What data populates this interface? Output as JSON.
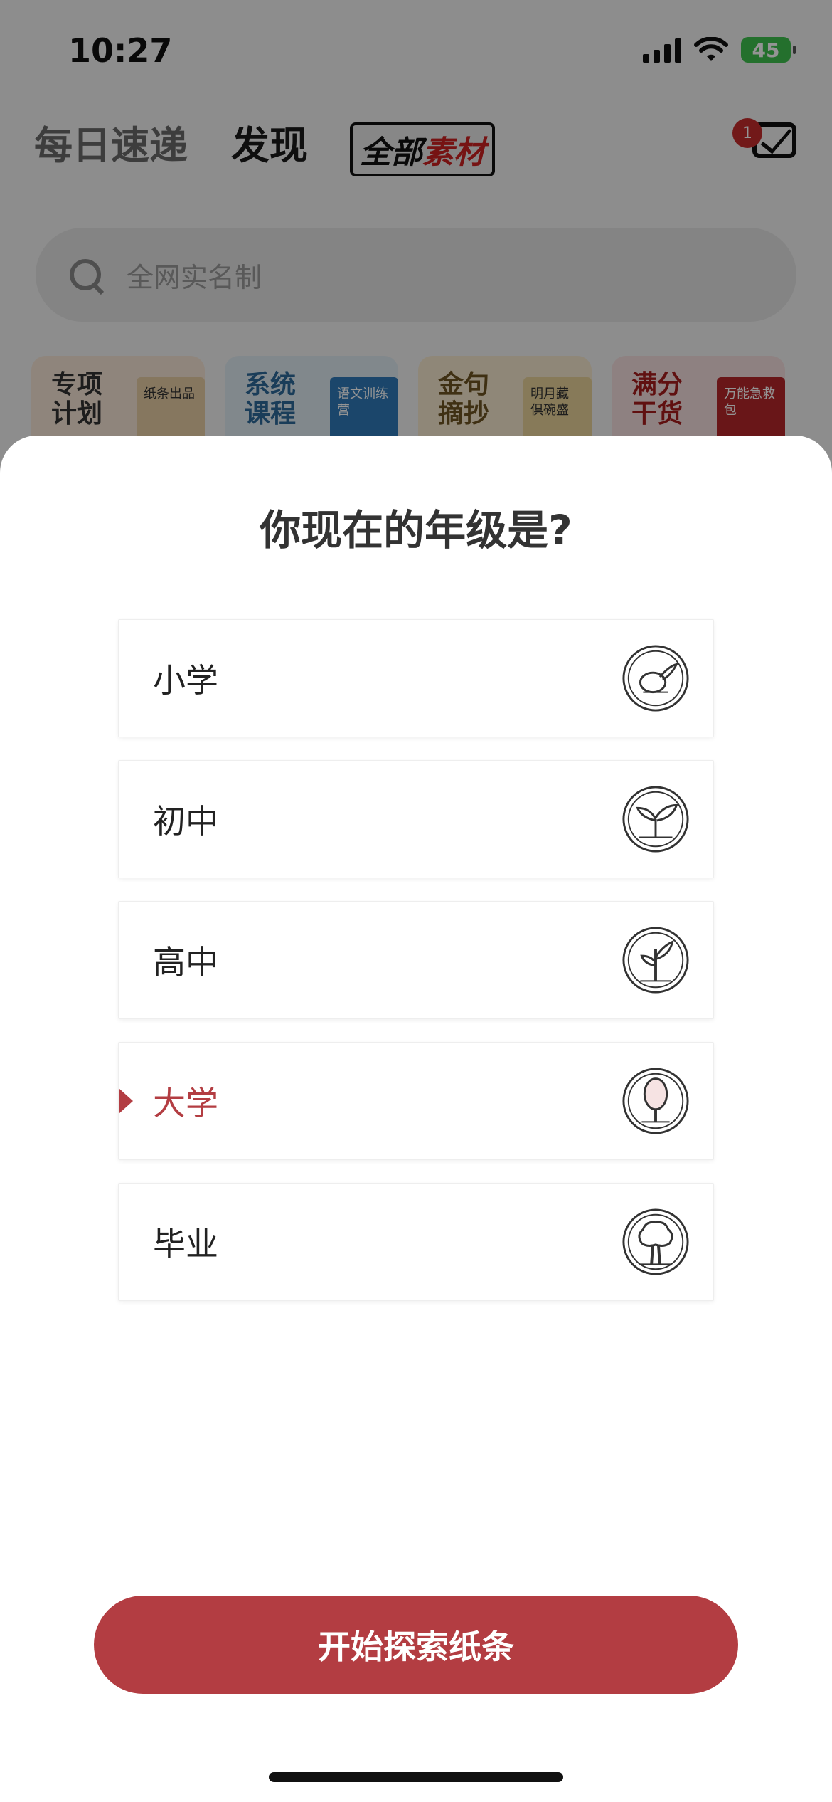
{
  "status_bar": {
    "time": "10:27",
    "battery": "45"
  },
  "top_nav": {
    "tabs": [
      {
        "label": "每日速递"
      },
      {
        "label": "发现"
      },
      {
        "label_a": "全部",
        "label_b": "素材"
      }
    ],
    "mail_badge": "1"
  },
  "search": {
    "placeholder": "全网实名制"
  },
  "features": [
    {
      "title_line1": "专项",
      "title_line2": "计划",
      "book": "纸条出品"
    },
    {
      "title_line1": "系统",
      "title_line2": "课程",
      "book": "语文训练营"
    },
    {
      "title_line1": "金句",
      "title_line2": "摘抄",
      "book": "明月藏 倶碗盛"
    },
    {
      "title_line1": "满分",
      "title_line2": "干货",
      "book": "万能急救包"
    }
  ],
  "sheet": {
    "title": "你现在的年级是?",
    "options": [
      {
        "label": "小学",
        "icon": "seed-icon",
        "selected": false
      },
      {
        "label": "初中",
        "icon": "sprout-icon",
        "selected": false
      },
      {
        "label": "高中",
        "icon": "sapling-icon",
        "selected": false
      },
      {
        "label": "大学",
        "icon": "young-tree-icon",
        "selected": true
      },
      {
        "label": "毕业",
        "icon": "grown-tree-icon",
        "selected": false
      }
    ],
    "cta_label": "开始探索纸条"
  },
  "colors": {
    "accent": "#b33d42",
    "badge": "#c52c2c",
    "battery": "#3fc14f"
  }
}
